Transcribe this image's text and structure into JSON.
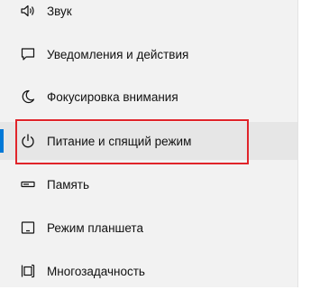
{
  "sidebar": {
    "items": [
      {
        "label": "Звук",
        "icon": "speaker-icon",
        "selected": false
      },
      {
        "label": "Уведомления и действия",
        "icon": "chat-bubble-icon",
        "selected": false
      },
      {
        "label": "Фокусировка внимания",
        "icon": "moon-icon",
        "selected": false
      },
      {
        "label": "Питание и спящий режим",
        "icon": "power-icon",
        "selected": true
      },
      {
        "label": "Память",
        "icon": "storage-icon",
        "selected": false
      },
      {
        "label": "Режим планшета",
        "icon": "tablet-icon",
        "selected": false
      },
      {
        "label": "Многозадачность",
        "icon": "multitasking-icon",
        "selected": false
      }
    ]
  },
  "colors": {
    "accent": "#0078d7",
    "highlight": "#e0242a",
    "panel_bg": "#f2f2f2",
    "selected_bg": "#e6e6e6"
  }
}
